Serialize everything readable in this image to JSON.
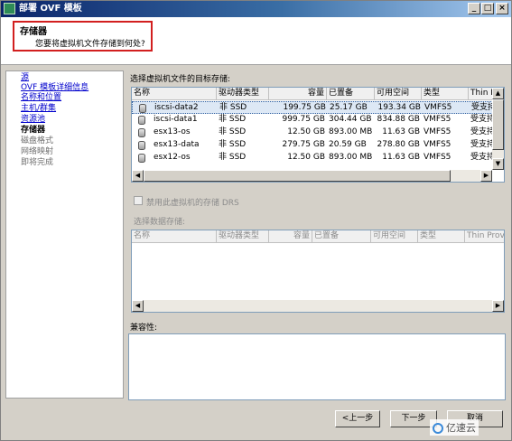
{
  "window": {
    "title": "部署 OVF 模板",
    "buttons": [
      "_",
      "□",
      "×"
    ]
  },
  "header": {
    "title": "存储器",
    "subtitle": "您要将虚拟机文件存储到何处?"
  },
  "nav": {
    "items": [
      {
        "label": "源",
        "state": "link"
      },
      {
        "label": "OVF 模板详细信息",
        "state": "link"
      },
      {
        "label": "名称和位置",
        "state": "link"
      },
      {
        "label": "主机/群集",
        "state": "link"
      },
      {
        "label": "资源池",
        "state": "link"
      },
      {
        "label": "存储器",
        "state": "current"
      },
      {
        "label": "磁盘格式",
        "state": "muted"
      },
      {
        "label": "网络映射",
        "state": "muted"
      },
      {
        "label": "即将完成",
        "state": "muted"
      }
    ]
  },
  "storage": {
    "label": "选择虚拟机文件的目标存储:",
    "columns": [
      "名称",
      "驱动器类型",
      "容量",
      "已置备",
      "可用空间",
      "类型",
      "Thin P"
    ],
    "rows": [
      {
        "name": "iscsi-data2",
        "drive": "非 SSD",
        "capacity": "199.75 GB",
        "provisioned": "25.17 GB",
        "free": "193.34 GB",
        "type": "VMFS5",
        "thin": "受支持",
        "selected": true
      },
      {
        "name": "iscsi-data1",
        "drive": "非 SSD",
        "capacity": "999.75 GB",
        "provisioned": "304.44 GB",
        "free": "834.88 GB",
        "type": "VMFS5",
        "thin": "受支持",
        "selected": false
      },
      {
        "name": "esx13-os",
        "drive": "非 SSD",
        "capacity": "12.50 GB",
        "provisioned": "893.00 MB",
        "free": "11.63 GB",
        "type": "VMFS5",
        "thin": "受支持",
        "selected": false
      },
      {
        "name": "esx13-data",
        "drive": "非 SSD",
        "capacity": "279.75 GB",
        "provisioned": "20.59 GB",
        "free": "278.80 GB",
        "type": "VMFS5",
        "thin": "受支持",
        "selected": false
      },
      {
        "name": "esx12-os",
        "drive": "非 SSD",
        "capacity": "12.50 GB",
        "provisioned": "893.00 MB",
        "free": "11.63 GB",
        "type": "VMFS5",
        "thin": "受支持",
        "selected": false
      }
    ]
  },
  "drs": {
    "checkbox_label": "禁用此虚拟机的存储 DRS",
    "checked": false
  },
  "datastore": {
    "label": "选择数据存储:",
    "columns": [
      "名称",
      "驱动器类型",
      "容量",
      "已置备",
      "可用空间",
      "类型",
      "Thin Provis"
    ]
  },
  "compat": {
    "label": "兼容性:"
  },
  "footer": {
    "back": "<上一步",
    "next": "下一步",
    "cancel": "取消"
  },
  "watermark": "亿速云"
}
